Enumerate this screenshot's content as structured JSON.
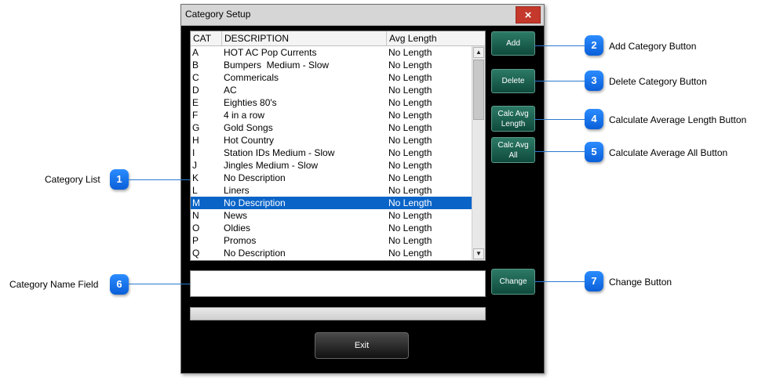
{
  "window": {
    "title": "Category Setup",
    "close_glyph": "×"
  },
  "list": {
    "columns": [
      "CAT",
      "DESCRIPTION",
      "Avg Length"
    ],
    "rows": [
      {
        "cat": "A",
        "desc": "HOT AC Pop Currents",
        "avg": "No Length"
      },
      {
        "cat": "B",
        "desc": "Bumpers  Medium - Slow",
        "avg": "No Length"
      },
      {
        "cat": "C",
        "desc": "Commericals",
        "avg": "No Length"
      },
      {
        "cat": "D",
        "desc": "AC",
        "avg": "No Length"
      },
      {
        "cat": "E",
        "desc": "Eighties 80's",
        "avg": "No Length"
      },
      {
        "cat": "F",
        "desc": "4 in a row",
        "avg": "No Length"
      },
      {
        "cat": "G",
        "desc": "Gold Songs",
        "avg": "No Length"
      },
      {
        "cat": "H",
        "desc": "Hot Country",
        "avg": "No Length"
      },
      {
        "cat": "I",
        "desc": "Station IDs Medium - Slow",
        "avg": "No Length"
      },
      {
        "cat": "J",
        "desc": "Jingles Medium - Slow",
        "avg": "No Length"
      },
      {
        "cat": "K",
        "desc": "No Description",
        "avg": "No Length"
      },
      {
        "cat": "L",
        "desc": "Liners",
        "avg": "No Length"
      },
      {
        "cat": "M",
        "desc": "No Description",
        "avg": "No Length",
        "selected": true
      },
      {
        "cat": "N",
        "desc": "News",
        "avg": "No Length"
      },
      {
        "cat": "O",
        "desc": "Oldies",
        "avg": "No Length"
      },
      {
        "cat": "P",
        "desc": "Promos",
        "avg": "No Length"
      },
      {
        "cat": "Q",
        "desc": "No Description",
        "avg": "No Length"
      }
    ]
  },
  "buttons": {
    "add": "Add",
    "delete": "Delete",
    "calc_avg_length": [
      "Calc Avg",
      "Length"
    ],
    "calc_avg_all": [
      "Calc Avg",
      "All"
    ],
    "change": "Change",
    "exit": "Exit"
  },
  "name_field": {
    "value": ""
  },
  "callouts": [
    {
      "num": "1",
      "label": "Category List"
    },
    {
      "num": "2",
      "label": "Add Category Button"
    },
    {
      "num": "3",
      "label": "Delete Category Button"
    },
    {
      "num": "4",
      "label": "Calculate Average Length Button"
    },
    {
      "num": "5",
      "label": "Calculate Average All Button"
    },
    {
      "num": "6",
      "label": "Category Name Field"
    },
    {
      "num": "7",
      "label": "Change Button"
    }
  ],
  "colors": {
    "accent": "#0a64c8",
    "button_green": "#1f6455",
    "callout_blue": "#1a7cf0"
  }
}
